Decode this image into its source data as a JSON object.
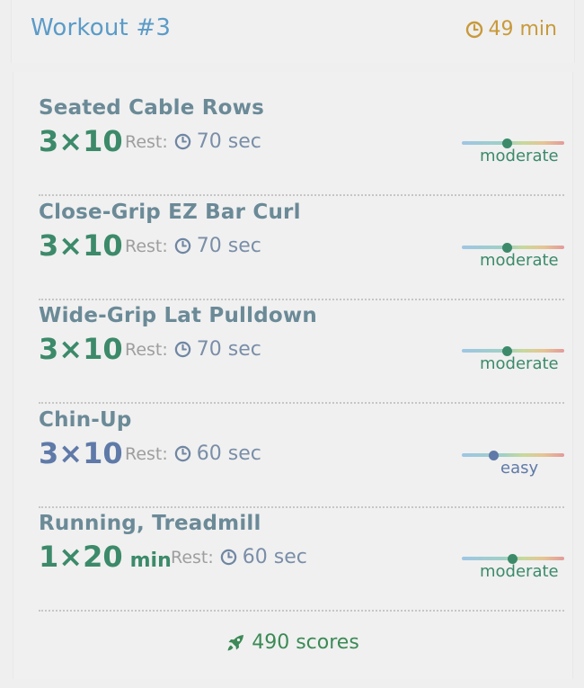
{
  "header": {
    "title": "Workout #3",
    "duration": "49 min",
    "duration_icon": "clock-icon",
    "title_color": "#5b9bc7",
    "duration_color": "#c89a3b"
  },
  "exercises": [
    {
      "name": "Seated Cable Rows",
      "sets": "3×10",
      "unit": "",
      "rest_label": "Rest:",
      "rest": "70 sec",
      "intensity": "moderate",
      "intensity_level": 0.45
    },
    {
      "name": "Close-Grip EZ Bar Curl",
      "sets": "3×10",
      "unit": "",
      "rest_label": "Rest:",
      "rest": "70 sec",
      "intensity": "moderate",
      "intensity_level": 0.45
    },
    {
      "name": "Wide-Grip Lat Pulldown",
      "sets": "3×10",
      "unit": "",
      "rest_label": "Rest:",
      "rest": "70 sec",
      "intensity": "moderate",
      "intensity_level": 0.45
    },
    {
      "name": "Chin-Up",
      "sets": "3×10",
      "unit": "",
      "rest_label": "Rest:",
      "rest": "60 sec",
      "intensity": "easy",
      "intensity_level": 0.3
    },
    {
      "name": "Running, Treadmill",
      "sets": "1×20",
      "unit": "min",
      "rest_label": "Rest:",
      "rest": "60 sec",
      "intensity": "moderate",
      "intensity_level": 0.5
    }
  ],
  "footer": {
    "scores": "490 scores",
    "icon": "rocket-icon"
  },
  "colors": {
    "moderate": "#3c8a6a",
    "easy": "#5f7aa8",
    "exercise_name": "#6b8a97",
    "rest_label": "#9e9e9e",
    "rest_value": "#7a8ea8",
    "scores": "#3c8a56"
  }
}
